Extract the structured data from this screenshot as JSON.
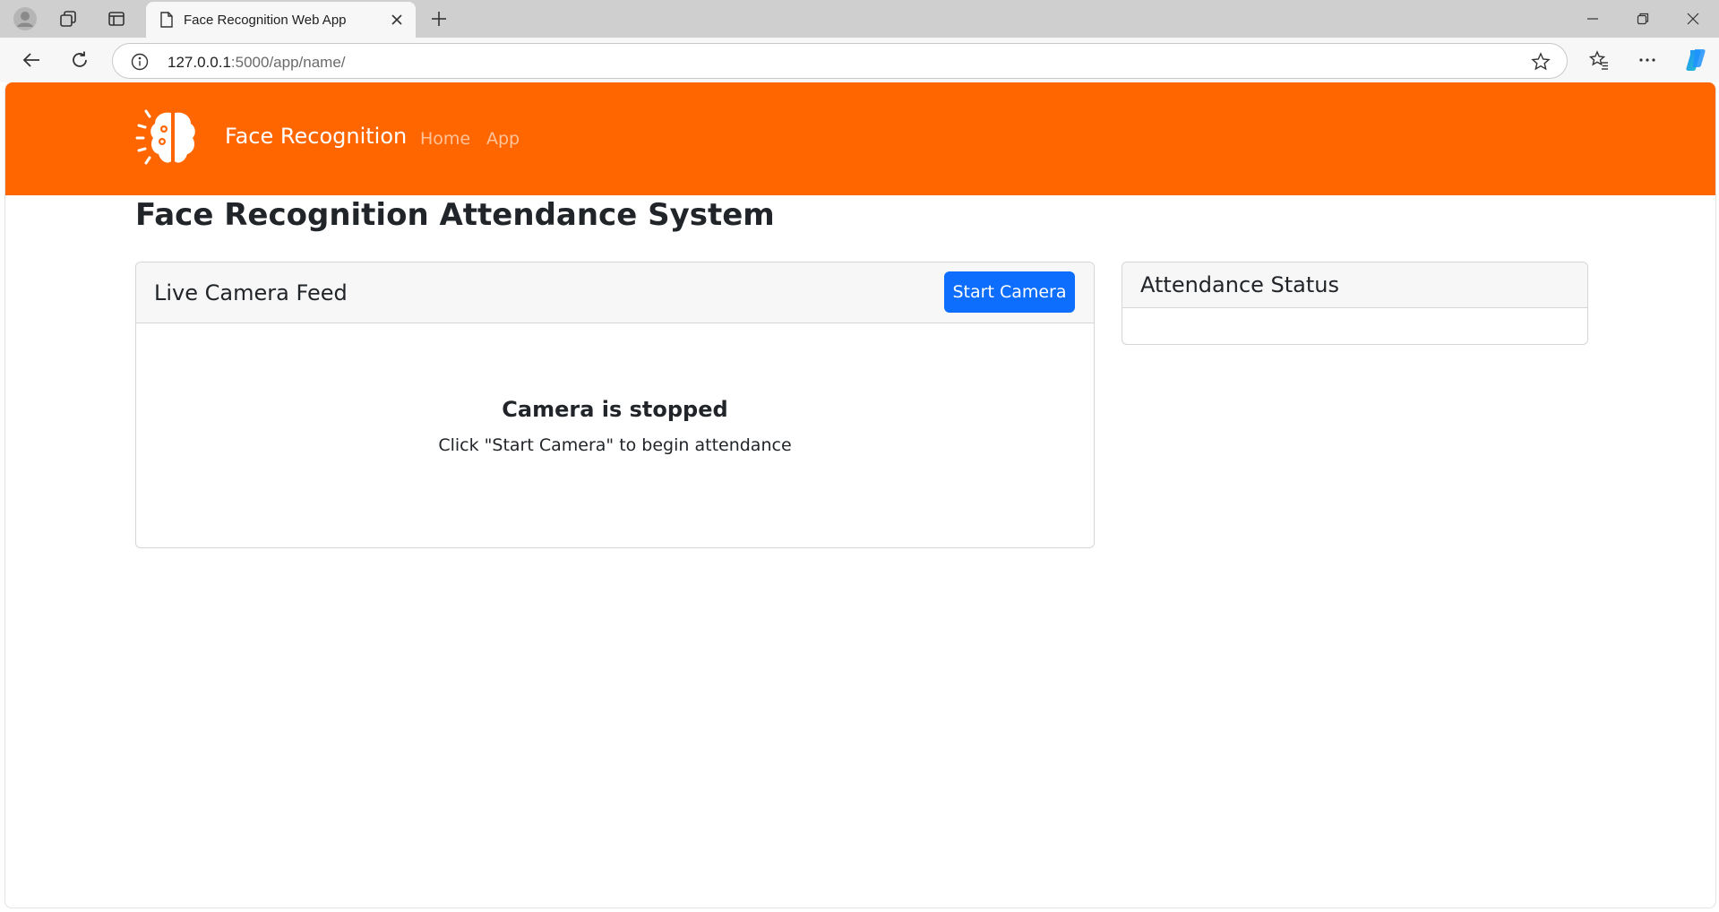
{
  "browser": {
    "tab_title": "Face Recognition Web App",
    "url_host": "127.0.0.1",
    "url_path": ":5000/app/name/"
  },
  "navbar": {
    "brand": "Face Recognition",
    "links": [
      "Home",
      "App"
    ],
    "color": "#ff6600"
  },
  "page": {
    "title": "Face Recognition Attendance System"
  },
  "camera_card": {
    "title": "Live Camera Feed",
    "start_button": "Start Camera",
    "status_title": "Camera is stopped",
    "status_hint": "Click \"Start Camera\" to begin attendance"
  },
  "attendance_card": {
    "title": "Attendance Status"
  },
  "colors": {
    "primary_button": "#0d6efd",
    "brand_orange": "#ff6600"
  }
}
